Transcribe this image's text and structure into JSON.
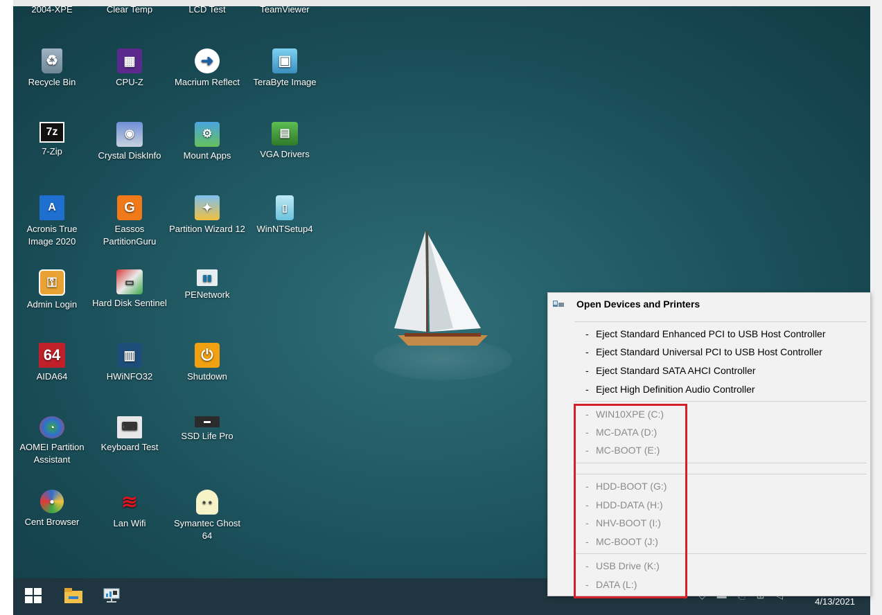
{
  "desktop": {
    "icons": [
      {
        "label": "2004-XPE",
        "icon": "top-cutoff-icon"
      },
      {
        "label": "Clear Temp",
        "icon": "top-cutoff-icon"
      },
      {
        "label": "LCD Test",
        "icon": "top-cutoff-icon"
      },
      {
        "label": "TeamViewer",
        "icon": "top-cutoff-icon"
      },
      {
        "label": "Recycle Bin",
        "icon": "recycle-bin-icon"
      },
      {
        "label": "CPU-Z",
        "icon": "cpuz-icon"
      },
      {
        "label": "Macrium Reflect",
        "icon": "macrium-icon"
      },
      {
        "label": "TeraByte Image",
        "icon": "terabyte-icon"
      },
      {
        "label": "7-Zip",
        "icon": "sevenzip-icon"
      },
      {
        "label": "Crystal DiskInfo",
        "icon": "crystal-diskinfo-icon"
      },
      {
        "label": "Mount Apps",
        "icon": "mount-apps-icon"
      },
      {
        "label": "VGA Drivers",
        "icon": "vga-drivers-icon"
      },
      {
        "label": "Acronis True Image 2020",
        "icon": "acronis-icon"
      },
      {
        "label": "Eassos PartitionGuru",
        "icon": "partitionguru-icon"
      },
      {
        "label": "Partition Wizard 12",
        "icon": "partition-wizard-icon"
      },
      {
        "label": "WinNTSetup4",
        "icon": "winntsetup-icon"
      },
      {
        "label": "Admin Login",
        "icon": "admin-login-icon"
      },
      {
        "label": "Hard Disk Sentinel",
        "icon": "hard-disk-sentinel-icon"
      },
      {
        "label": "PENetwork",
        "icon": "penetwork-icon"
      },
      {
        "label": "AIDA64",
        "icon": "aida64-icon"
      },
      {
        "label": "HWiNFO32",
        "icon": "hwinfo-icon"
      },
      {
        "label": "Shutdown",
        "icon": "power-icon"
      },
      {
        "label": "AOMEI Partition Assistant",
        "icon": "aomei-icon"
      },
      {
        "label": "Keyboard Test",
        "icon": "keyboard-test-icon"
      },
      {
        "label": "SSD Life Pro",
        "icon": "ssd-icon"
      },
      {
        "label": "Cent Browser",
        "icon": "cent-browser-icon"
      },
      {
        "label": "Lan Wifi",
        "icon": "wifi-icon"
      },
      {
        "label": "Symantec Ghost 64",
        "icon": "ghost-icon"
      }
    ]
  },
  "menu": {
    "header": "Open Devices and Printers",
    "header_icon": "devices-printers-icon",
    "eject_items": [
      "Eject Standard Enhanced PCI to USB Host Controller",
      "Eject Standard Universal PCI to USB Host Controller",
      "Eject Standard SATA AHCI Controller",
      "Eject High Definition Audio Controller"
    ],
    "group1": [
      "WIN10XPE (C:)",
      "MC-DATA (D:)",
      "MC-BOOT (E:)"
    ],
    "group2": [
      "HDD-BOOT (G:)",
      "HDD-DATA (H:)",
      "NHV-BOOT (I:)",
      "MC-BOOT (J:)"
    ],
    "group3": [
      "USB Drive (K:)",
      "DATA (L:)"
    ],
    "dash": "-"
  },
  "taskbar": {
    "clock": "4/13/2021",
    "buttons": [
      "start-icon",
      "file-explorer-icon",
      "penetwork-icon"
    ]
  },
  "colors": {
    "highlight_box": "#d4202a",
    "desktop_bg": "#1d4f59",
    "taskbar_bg": "#1f3640"
  }
}
